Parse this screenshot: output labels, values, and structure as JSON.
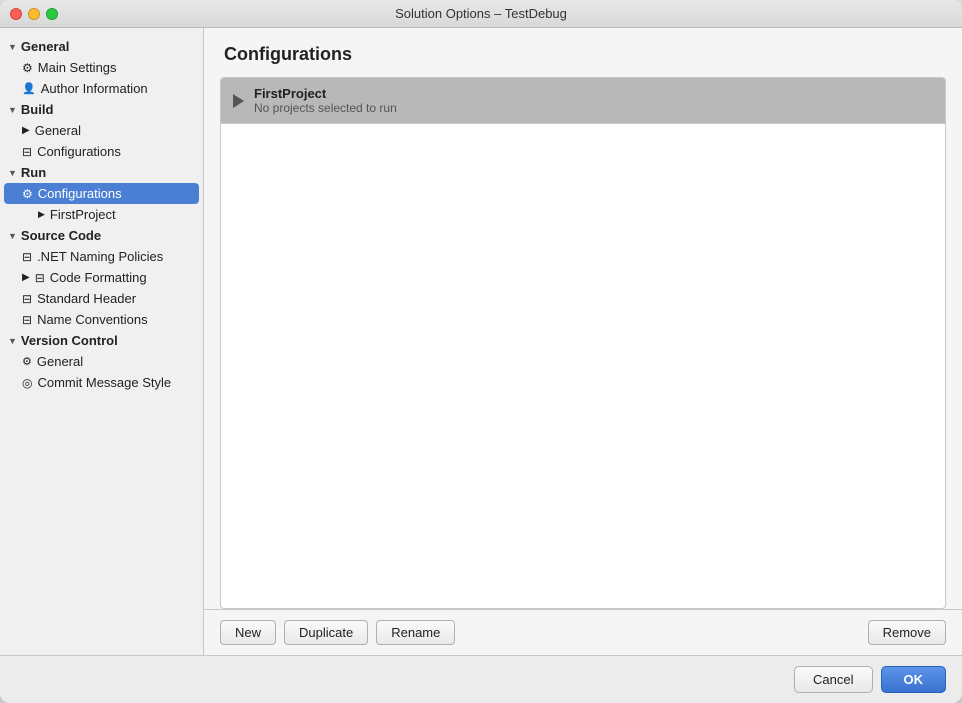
{
  "window": {
    "title": "Solution Options – TestDebug"
  },
  "sidebar": {
    "sections": [
      {
        "id": "general",
        "label": "General",
        "expanded": true,
        "items": [
          {
            "id": "main-settings",
            "label": "Main Settings",
            "icon": "gear",
            "indent": 1
          },
          {
            "id": "author-information",
            "label": "Author Information",
            "icon": "person",
            "indent": 1
          }
        ]
      },
      {
        "id": "build",
        "label": "Build",
        "expanded": true,
        "items": [
          {
            "id": "build-general",
            "label": "General",
            "icon": "general",
            "indent": 1
          },
          {
            "id": "configurations",
            "label": "Configurations",
            "icon": "config",
            "indent": 1
          }
        ]
      },
      {
        "id": "run",
        "label": "Run",
        "expanded": true,
        "items": [
          {
            "id": "run-configurations",
            "label": "Configurations",
            "icon": "gear",
            "indent": 1,
            "active": true
          },
          {
            "id": "run-firstproject",
            "label": "FirstProject",
            "icon": "play",
            "indent": 2
          }
        ]
      },
      {
        "id": "source-code",
        "label": "Source Code",
        "expanded": true,
        "items": [
          {
            "id": "net-naming",
            "label": ".NET Naming Policies",
            "icon": "naming",
            "indent": 1
          },
          {
            "id": "code-formatting",
            "label": "Code Formatting",
            "icon": "formatting",
            "indent": 1,
            "hasArrow": true
          },
          {
            "id": "standard-header",
            "label": "Standard Header",
            "icon": "header",
            "indent": 1
          },
          {
            "id": "name-conventions",
            "label": "Name Conventions",
            "icon": "conventions",
            "indent": 1
          }
        ]
      },
      {
        "id": "version-control",
        "label": "Version Control",
        "expanded": true,
        "items": [
          {
            "id": "vc-general",
            "label": "General",
            "icon": "vcs-general",
            "indent": 1
          },
          {
            "id": "commit-message",
            "label": "Commit Message Style",
            "icon": "commit",
            "indent": 1
          }
        ]
      }
    ]
  },
  "main": {
    "title": "Configurations",
    "config_item": {
      "name": "FirstProject",
      "subtitle": "No projects selected to run"
    }
  },
  "toolbar": {
    "new_label": "New",
    "duplicate_label": "Duplicate",
    "rename_label": "Rename",
    "remove_label": "Remove"
  },
  "footer": {
    "cancel_label": "Cancel",
    "ok_label": "OK"
  }
}
